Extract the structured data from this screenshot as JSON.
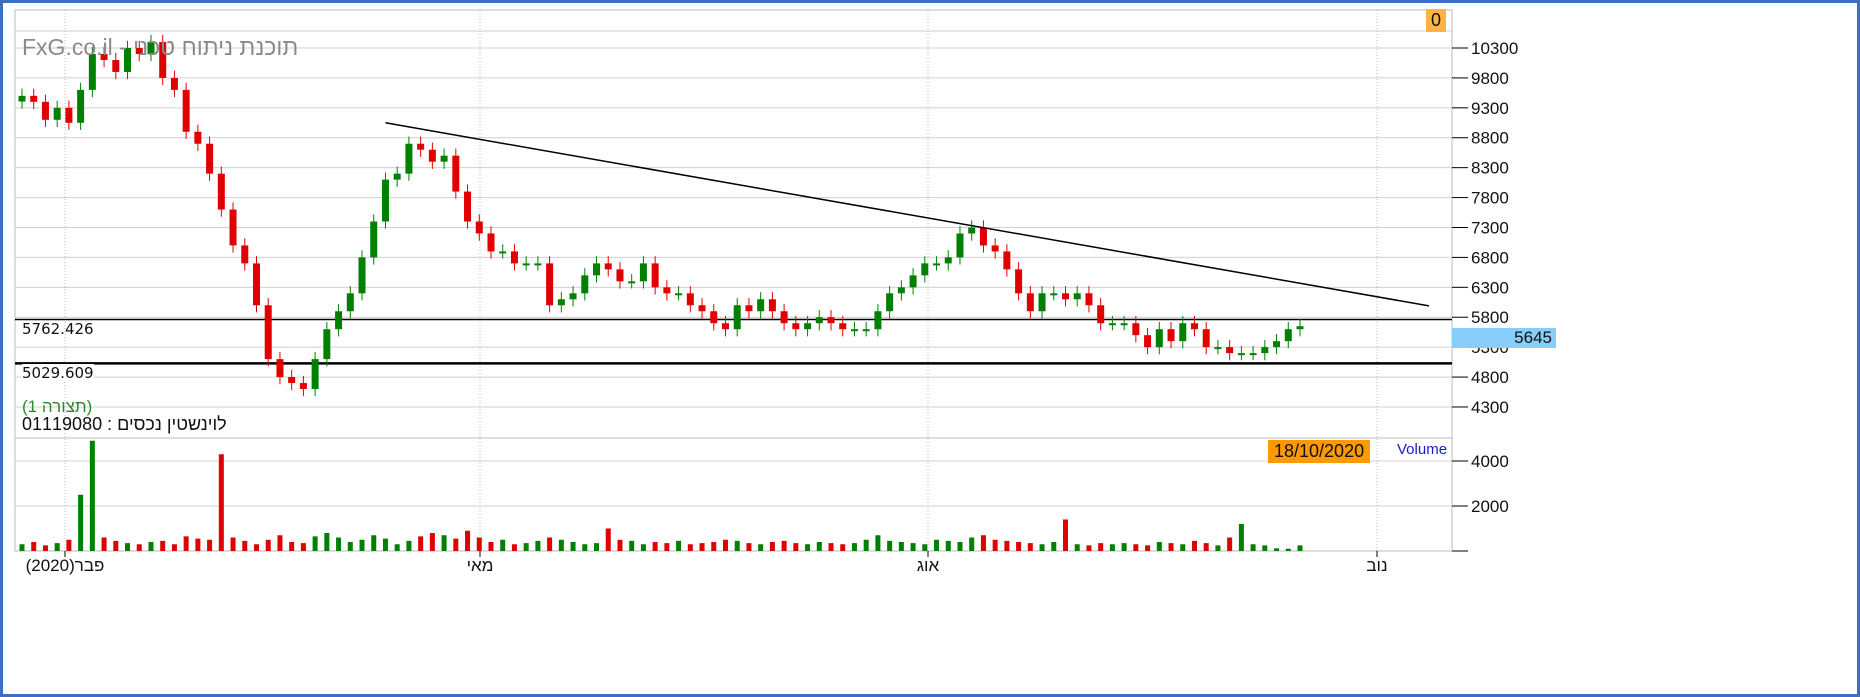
{
  "watermark": "FxG.co.il - תוכנת ניתוח טכני",
  "top_badge": "0",
  "current_price": "5645",
  "layout_label": "(תצורה 1)",
  "security_label": "לוינשטין נכסים : 01119080",
  "date_badge": "18/10/2020",
  "volume_label": "Volume",
  "h_lines": [
    {
      "value": 5762.426,
      "label": "5762.426"
    },
    {
      "value": 5029.609,
      "label": "5029.609"
    }
  ],
  "colors": {
    "up": "#008000",
    "down": "#e00000",
    "badge": "#ff9900",
    "price_tag": "#87cefa",
    "frame": "#3a6fc4"
  },
  "chart_data": {
    "type": "candlestick",
    "title": "לוינשטין נכסים : 01119080",
    "price_axis": {
      "ticks": [
        10300,
        9800,
        9300,
        8800,
        8300,
        7800,
        7300,
        6800,
        6300,
        5800,
        5300,
        4800,
        4300
      ],
      "range": [
        4300,
        10300
      ]
    },
    "volume_axis": {
      "ticks": [
        4000,
        2000
      ],
      "range": [
        0,
        4000
      ]
    },
    "x_labels": [
      "(2020)פבר",
      "מאי",
      "אוג",
      "נוב"
    ],
    "close": [
      9500,
      9400,
      9100,
      9300,
      9050,
      9600,
      10200,
      10100,
      9900,
      10300,
      10200,
      10400,
      9800,
      9600,
      8900,
      8700,
      8200,
      7600,
      7000,
      6700,
      6000,
      5100,
      4800,
      4700,
      4600,
      5100,
      5600,
      5900,
      6200,
      6800,
      7400,
      8100,
      8200,
      8700,
      8600,
      8400,
      8500,
      7900,
      7400,
      7200,
      6900,
      6900,
      6700,
      6700,
      6700,
      6000,
      6100,
      6200,
      6500,
      6700,
      6600,
      6400,
      6400,
      6700,
      6300,
      6200,
      6200,
      6000,
      5900,
      5700,
      5600,
      6000,
      5900,
      6100,
      5900,
      5700,
      5600,
      5700,
      5800,
      5700,
      5600,
      5600,
      5600,
      5900,
      6200,
      6300,
      6500,
      6700,
      6700,
      6800,
      7200,
      7300,
      7000,
      6900,
      6600,
      6200,
      5900,
      6200,
      6200,
      6100,
      6200,
      6000,
      5700,
      5700,
      5700,
      5500,
      5300,
      5600,
      5400,
      5700,
      5600,
      5300,
      5300,
      5200,
      5200,
      5200,
      5300,
      5400,
      5600,
      5650
    ],
    "volume": [
      300,
      400,
      250,
      350,
      500,
      2500,
      4900,
      600,
      450,
      350,
      300,
      400,
      450,
      300,
      650,
      550,
      500,
      4300,
      600,
      450,
      300,
      500,
      700,
      400,
      350,
      650,
      800,
      600,
      400,
      500,
      700,
      550,
      300,
      450,
      650,
      800,
      700,
      550,
      900,
      600,
      400,
      500,
      300,
      350,
      450,
      600,
      500,
      400,
      300,
      350,
      1000,
      500,
      450,
      300,
      400,
      350,
      450,
      300,
      350,
      400,
      500,
      450,
      350,
      300,
      400,
      450,
      350,
      300,
      400,
      350,
      300,
      350,
      500,
      700,
      450,
      400,
      350,
      300,
      500,
      450,
      400,
      600,
      700,
      500,
      450,
      400,
      350,
      300,
      400,
      1400,
      300,
      250,
      350,
      300,
      350,
      300,
      250,
      400,
      350,
      300,
      450,
      350,
      250,
      600,
      1200,
      300,
      250,
      120,
      100,
      250
    ],
    "trendline": {
      "from": {
        "index": 31,
        "price": 9050
      },
      "to": {
        "index": 120,
        "price": 5990
      }
    }
  }
}
